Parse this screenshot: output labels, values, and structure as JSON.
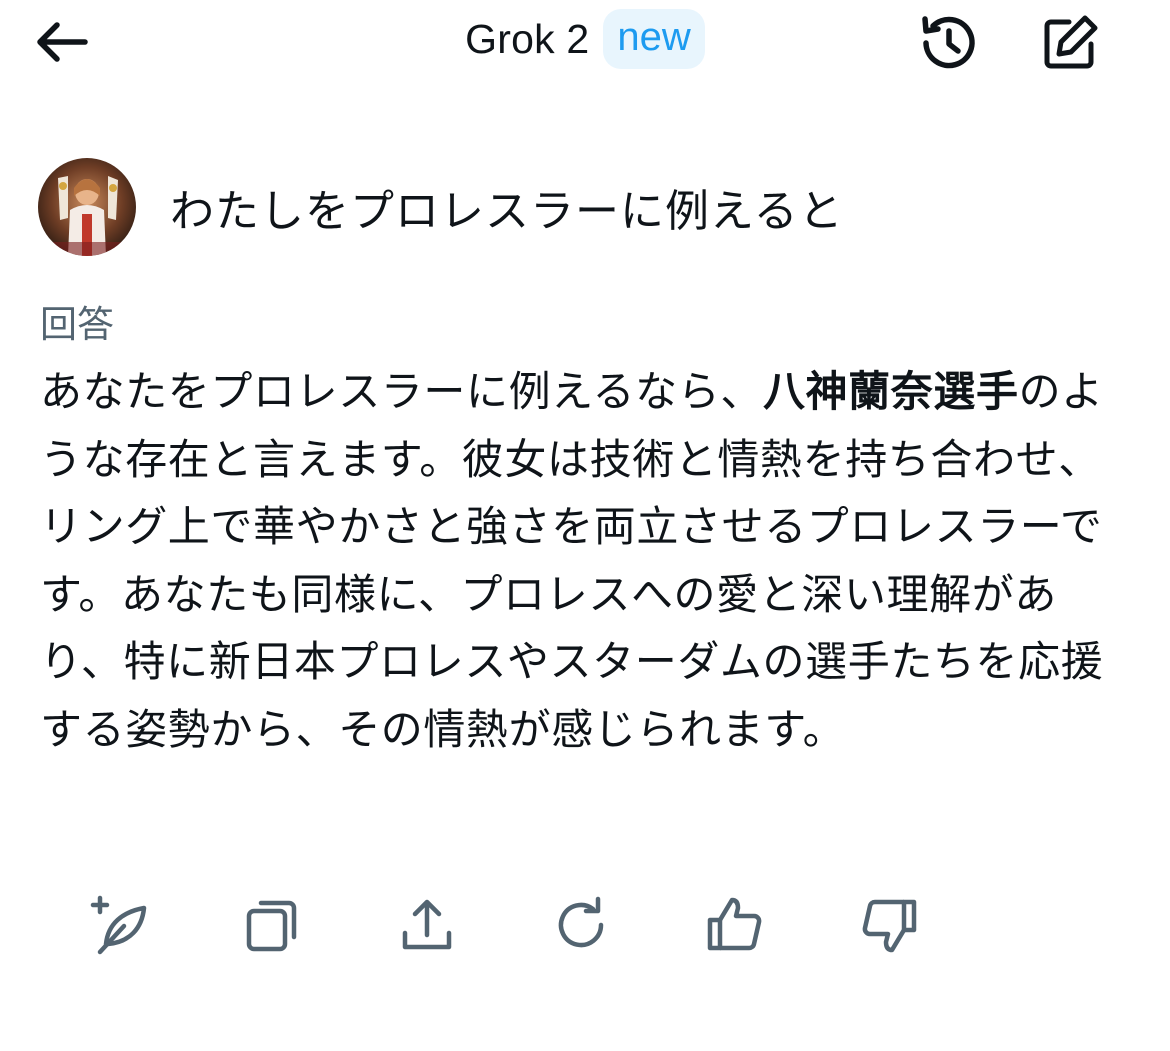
{
  "header": {
    "title": "Grok 2",
    "badge": "new",
    "back_icon": "arrow-left-icon",
    "history_icon": "history-icon",
    "compose_icon": "compose-icon"
  },
  "prompt": {
    "text": "わたしをプロレスラーに例えると"
  },
  "answer": {
    "label": "回答",
    "part1": "あなたをプロレスラーに例えるなら、",
    "bold": "八神蘭奈選手",
    "part2": "のような存在と言えます。彼女は技術と情熱を持ち合わせ、リング上で華やかさと強さを両立させるプロレスラーです。あなたも同様に、プロレスへの愛と深い理解があり、特に新日本プロレスやスターダムの選手たちを応援する姿勢から、その情熱が感じられます。"
  },
  "actions": [
    {
      "name": "new-chat-sparkle-button",
      "icon": "feather-plus-icon"
    },
    {
      "name": "copy-button",
      "icon": "copy-icon"
    },
    {
      "name": "share-button",
      "icon": "share-icon"
    },
    {
      "name": "regenerate-button",
      "icon": "refresh-icon"
    },
    {
      "name": "thumbs-up-button",
      "icon": "thumbs-up-icon"
    },
    {
      "name": "thumbs-down-button",
      "icon": "thumbs-down-icon"
    }
  ],
  "colors": {
    "text": "#0f1419",
    "muted": "#536471",
    "accent": "#1d9bf0",
    "badge_bg": "#e8f5fd"
  }
}
